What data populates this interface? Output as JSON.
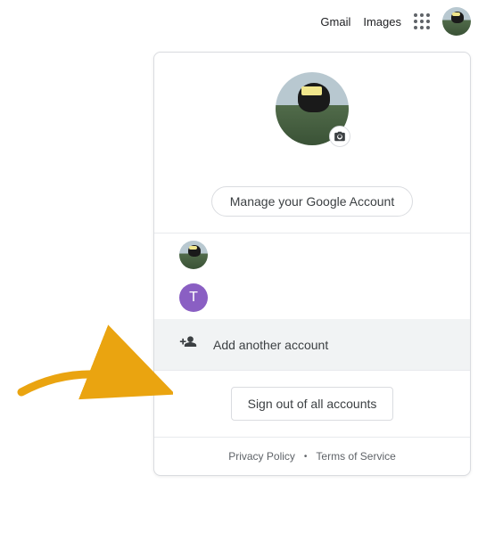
{
  "topbar": {
    "gmail": "Gmail",
    "images": "Images"
  },
  "panel": {
    "manage_label": "Manage your Google Account",
    "accounts": [
      {
        "initial": ""
      },
      {
        "initial": "T"
      }
    ],
    "add_account_label": "Add another account",
    "signout_label": "Sign out of all accounts",
    "privacy": "Privacy Policy",
    "terms": "Terms of Service"
  },
  "colors": {
    "arrow": "#eaa410",
    "purple_avatar": "#8a5fc3"
  }
}
